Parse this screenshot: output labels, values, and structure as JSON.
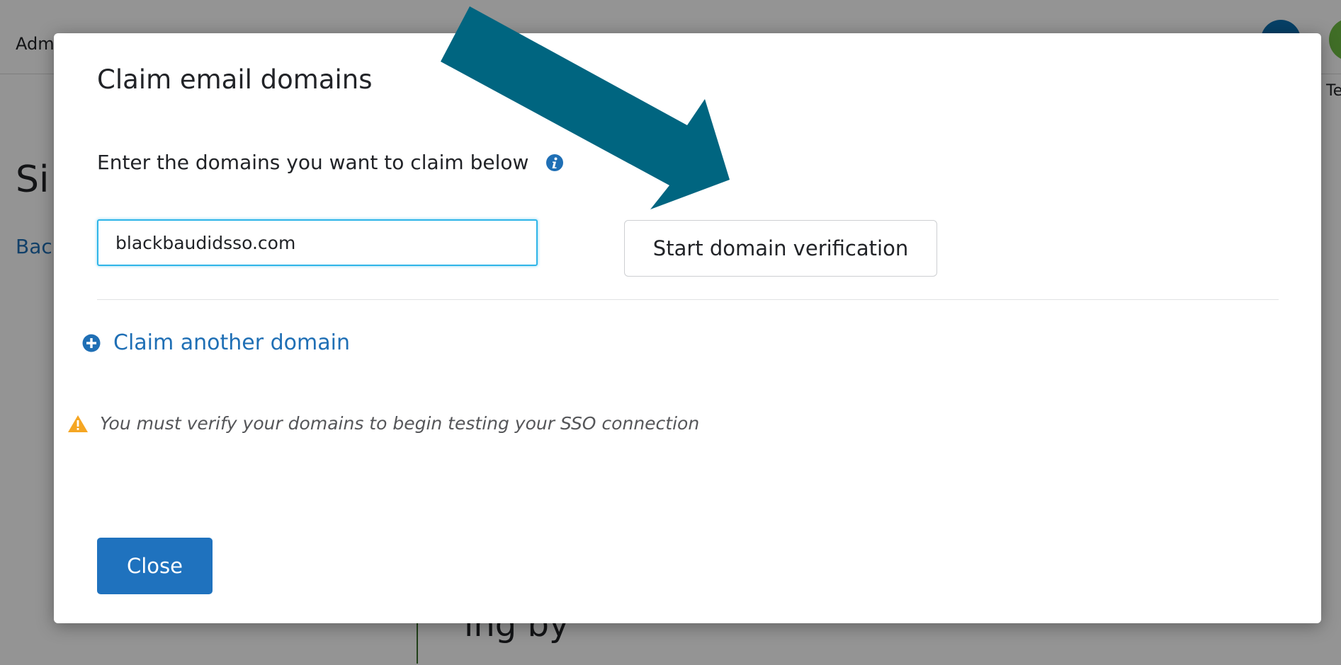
{
  "background": {
    "app_name_fragment": "Adm",
    "heading_fragment": "Si",
    "link_fragment": "Back",
    "user_label_fragment": "Tes",
    "lower_text_fragment": "ing by"
  },
  "modal": {
    "title": "Claim email domains",
    "instructions": "Enter the domains you want to claim below",
    "domain_input_value": "blackbaudidsso.com",
    "verify_button_label": "Start domain verification",
    "claim_another_label": "Claim another domain",
    "warning_text": "You must verify your domains to begin testing your SSO connection",
    "close_button_label": "Close"
  },
  "icons": {
    "info": "info-icon",
    "plus": "plus-circle-icon",
    "warning": "warning-icon",
    "callout": "arrow-icon"
  },
  "colors": {
    "accent": "#1f72be",
    "link": "#1f6fb5",
    "input_focus": "#2fb5e8",
    "warning": "#f5a623",
    "arrow": "#006580"
  }
}
